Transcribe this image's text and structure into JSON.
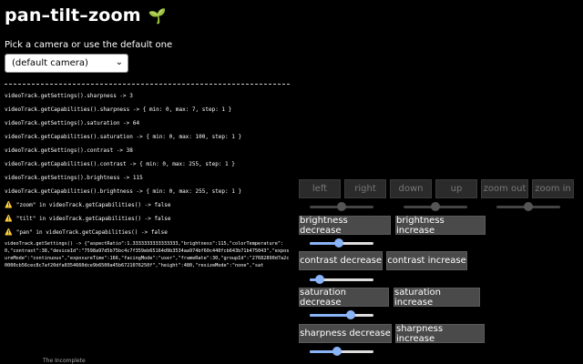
{
  "header": {
    "title": "pan–tilt–zoom",
    "icon": "seedling-icon"
  },
  "camera": {
    "prompt": "Pick a camera or use the default one",
    "selected": "(default camera)"
  },
  "log": [
    {
      "text": "videoTrack.getSettings().sharpness -> 3"
    },
    {
      "text": "videoTrack.getCapabilities().sharpness -> { min: 0, max: 7, step: 1 }"
    },
    {
      "text": "videoTrack.getSettings().saturation -> 64"
    },
    {
      "text": "videoTrack.getCapabilities().saturation -> { min: 0, max: 100, step: 1 }"
    },
    {
      "text": "videoTrack.getSettings().contrast -> 38"
    },
    {
      "text": "videoTrack.getCapabilities().contrast -> { min: 0, max: 255, step: 1 }"
    },
    {
      "text": "videoTrack.getSettings().brightness -> 115"
    },
    {
      "text": "videoTrack.getCapabilities().brightness -> { min: 0, max: 255, step: 1 }"
    },
    {
      "text": "\"zoom\" in videoTrack.getCapabilities() -> false",
      "warn": "⚠️"
    },
    {
      "text": "\"tilt\" in videoTrack.getCapabilities() -> false",
      "warn": "⚠️"
    },
    {
      "text": "\"pan\" in videoTrack.getCapabilities() -> false",
      "warn": "⚠️"
    }
  ],
  "settings_json": "videoTrack.getSettings() -> {\"aspectRatio\":1.3333333333333333,\"brightness\":115,\"colorTemperature\":0,\"contrast\":38,\"deviceId\":\"7598a97d5b75bc4c7f359eb65164d9b3534aa974bf60c440fcb643b71b475043\",\"exposureMode\":\"continuous\",\"exposureTime\":166,\"facingMode\":\"user\",\"frameRate\":30,\"groupId\":\"27682890d7a2c0000cb56cec8c7af20dfa0354660dce9b6500a45b6721076250f\",\"height\":480,\"resizeMode\":\"none\",\"sat",
  "footer": "The Incomplete",
  "ptz": {
    "left": "left",
    "right": "right",
    "down": "down",
    "up": "up",
    "zoom_out": "zoom out",
    "zoom_in": "zoom in"
  },
  "controls": {
    "brightness": {
      "decrease": "brightness decrease",
      "increase": "brightness increase",
      "level": 0.45
    },
    "contrast": {
      "decrease": "contrast decrease",
      "increase": "contrast increase",
      "level": 0.15
    },
    "saturation": {
      "decrease": "saturation decrease",
      "increase": "saturation increase",
      "level": 0.64
    },
    "sharpness": {
      "decrease": "sharpness decrease",
      "increase": "sharpness increase",
      "level": 0.43
    }
  },
  "disabled_sliders": {
    "pan": 0.5,
    "tilt": 0.5,
    "zoom": 0.5
  }
}
